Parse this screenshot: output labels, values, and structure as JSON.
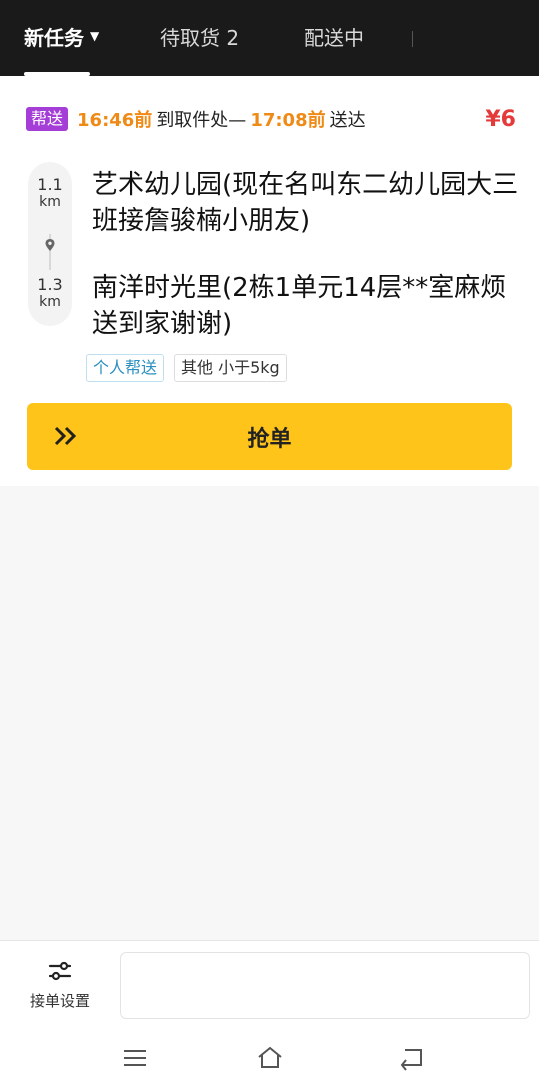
{
  "tabs": {
    "new_tasks": "新任务",
    "pending_pickup": "待取货 2",
    "delivering": "配送中"
  },
  "order": {
    "type_tag": "帮送",
    "pickup_time": "16:46前",
    "pickup_text": "到取件处—",
    "deliver_time": "17:08前",
    "deliver_text": "送达",
    "price": "¥6",
    "pickup_distance": {
      "value": "1.1",
      "unit": "km"
    },
    "drop_distance": {
      "value": "1.3",
      "unit": "km"
    },
    "pickup_address": "艺术幼儿园(现在名叫东二幼儿园大三班接詹骏楠小朋友)",
    "drop_address": "南洋时光里(2栋1单元14层**室麻烦送到家谢谢)",
    "tags": [
      "个人帮送",
      "其他 小于5kg"
    ],
    "grab_label": "抢单"
  },
  "bottom": {
    "settings_label": "接单设置"
  },
  "colors": {
    "accent_yellow": "#ffc41a",
    "time_orange": "#f08a16",
    "price_red": "#e53a3a",
    "tag_purple": "#a43ed6",
    "chip_blue": "#2a8fbf"
  },
  "icons": {
    "location_pin": "location-pin-icon",
    "grab_arrows": "double-chevron-right-icon",
    "settings": "sliders-icon",
    "nav_menu": "menu-icon",
    "nav_home": "home-icon",
    "nav_back": "back-icon"
  }
}
